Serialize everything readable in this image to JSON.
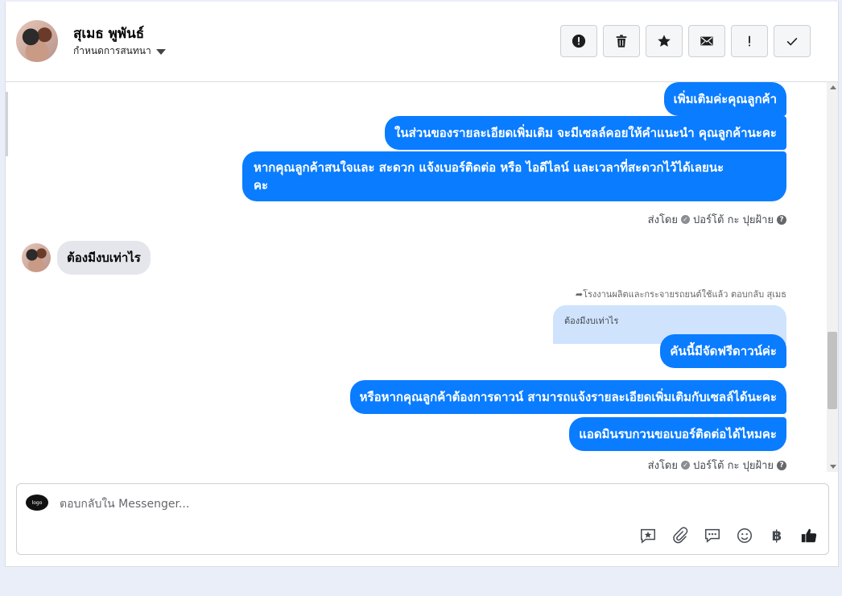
{
  "header": {
    "contact_name": "สุเมธ พูพันธ์",
    "assign_label": "กำหนดการสนทนา",
    "actions": [
      {
        "name": "report-button",
        "icon": "alert-circle-icon"
      },
      {
        "name": "delete-button",
        "icon": "trash-icon"
      },
      {
        "name": "star-button",
        "icon": "star-icon"
      },
      {
        "name": "mark-unread-button",
        "icon": "envelope-icon"
      },
      {
        "name": "follow-up-button",
        "icon": "exclamation-icon"
      },
      {
        "name": "mark-done-button",
        "icon": "checkmark-icon"
      }
    ]
  },
  "messages": {
    "m1": "เพิ่มเติมค่ะคุณลูกค้า",
    "m2": "ในส่วนของรายละเอียดเพิ่มเติม จะมีเซลล์คอยให้คำแนะนำ คุณลูกค้านะคะ",
    "m3_line1": "หากคุณลูกค้าสนใจและ สะดวก แจ้งเบอร์ติดต่อ หรือ ไอดีไลน์ และเวลาที่สะดวกไว้ได้เลยนะ",
    "m3_line2": "คะ",
    "sent_by_label": "ส่งโดย",
    "sent_by_name": "ปอร์โต้ กะ ปุยฝ้าย",
    "incoming": "ต้องมีงบเท่าไร",
    "reply_note": "โรงงานผลิตและกระจายรถยนต์ใช้แล้ว ตอบกลับ สุเมธ",
    "quoted": "ต้องมีงบเท่าไร",
    "m4": "คันนี้มีจัดฟรีดาวน์ค่ะ",
    "m5": "หรือหากคุณลูกค้าต้องการดาวน์ สามารถแจ้งรายละเอียดเพิ่มเติมกับเซลล์ได้นะคะ",
    "m6": "แอดมินรบกวนขอเบอร์ติดต่อได้ไหมคะ",
    "sent_by_label_2": "ส่งโดย",
    "sent_by_name_2": "ปอร์โต้ กะ ปุยฝ้าย"
  },
  "composer": {
    "placeholder": "ตอบกลับใน Messenger...",
    "page_logo_text": "logo",
    "tools": [
      "saved-reply-icon",
      "paperclip-icon",
      "chat-bubbles-icon",
      "smiley-icon",
      "baht-icon",
      "thumbs-up-icon"
    ],
    "baht_symbol": "฿"
  },
  "colors": {
    "outgoing": "#0a7cff",
    "incoming": "#e4e6eb",
    "quote": "#cfe3fd"
  }
}
